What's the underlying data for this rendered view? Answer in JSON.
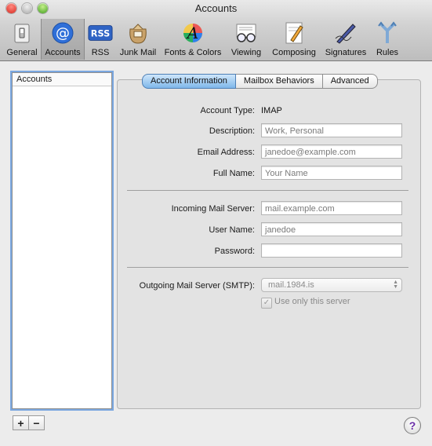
{
  "window": {
    "title": "Accounts"
  },
  "toolbar": {
    "items": [
      {
        "label": "General",
        "icon": "general-switch-icon"
      },
      {
        "label": "Accounts",
        "icon": "at-sign-icon",
        "selected": true
      },
      {
        "label": "RSS",
        "icon": "rss-icon",
        "icon_text": "RSS"
      },
      {
        "label": "Junk Mail",
        "icon": "junk-mail-bag-icon"
      },
      {
        "label": "Fonts & Colors",
        "icon": "fonts-colors-icon",
        "icon_text": "A"
      },
      {
        "label": "Viewing",
        "icon": "viewing-glasses-icon"
      },
      {
        "label": "Composing",
        "icon": "composing-pencil-icon"
      },
      {
        "label": "Signatures",
        "icon": "signature-pen-icon"
      },
      {
        "label": "Rules",
        "icon": "rules-arrows-icon"
      }
    ]
  },
  "sidebar": {
    "header": "Accounts"
  },
  "list_controls": {
    "add": "+",
    "remove": "−"
  },
  "tabs": [
    {
      "label": "Account Information",
      "active": true
    },
    {
      "label": "Mailbox Behaviors"
    },
    {
      "label": "Advanced"
    }
  ],
  "form": {
    "account_type_label": "Account Type:",
    "account_type_value": "IMAP",
    "description_label": "Description:",
    "description_placeholder": "Work, Personal",
    "email_label": "Email Address:",
    "email_placeholder": "janedoe@example.com",
    "fullname_label": "Full Name:",
    "fullname_placeholder": "Your Name",
    "incoming_label": "Incoming Mail Server:",
    "incoming_placeholder": "mail.example.com",
    "username_label": "User Name:",
    "username_placeholder": "janedoe",
    "password_label": "Password:",
    "password_value": "",
    "smtp_label": "Outgoing Mail Server (SMTP):",
    "smtp_value": "mail.1984.is",
    "only_server_label": "Use only this server",
    "only_server_checked": true
  },
  "help": {
    "label": "?"
  },
  "colors": {
    "accent_tab": "#7fb7ea",
    "help": "#6a2da8"
  }
}
